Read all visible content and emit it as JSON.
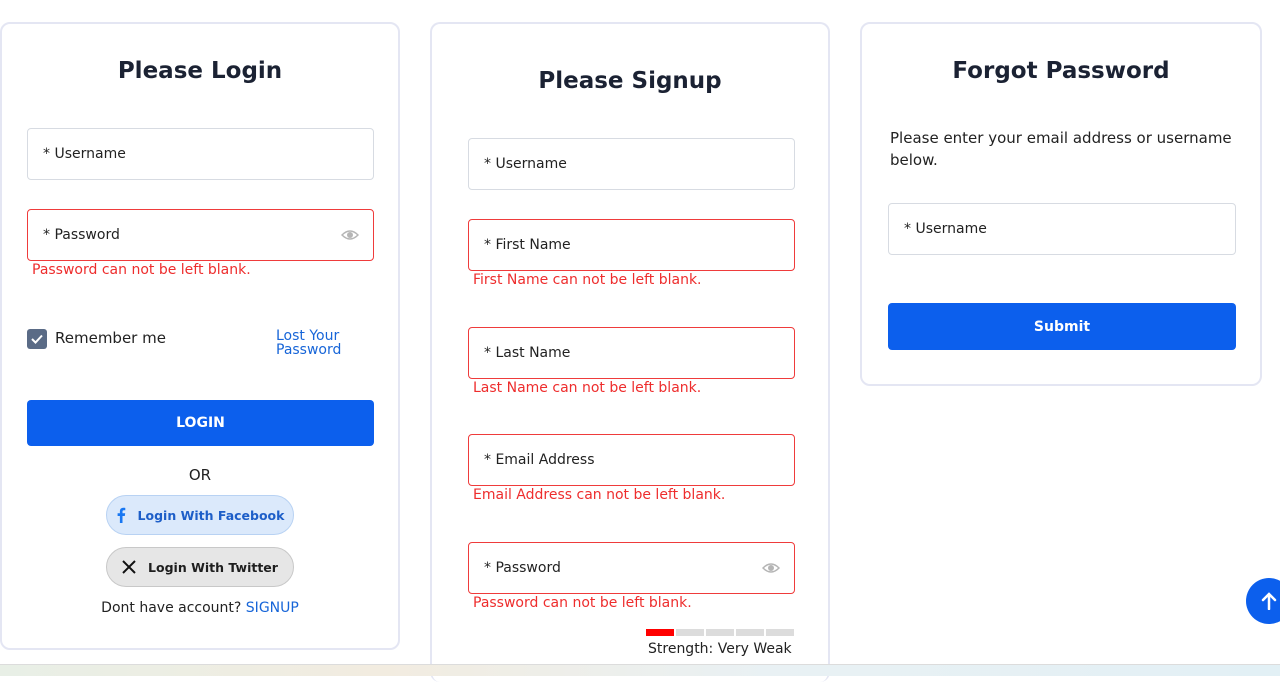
{
  "login": {
    "title": "Please Login",
    "username_placeholder": "* Username",
    "password_placeholder": "* Password",
    "password_error": "Password can not be left blank.",
    "remember_label": "Remember me",
    "lost_password_line1": "Lost Your",
    "lost_password_line2": "Password",
    "login_button": "LOGIN",
    "or_text": "OR",
    "facebook_button": "Login With Facebook",
    "twitter_button": "Login With Twitter",
    "no_account_text": "Dont have account?",
    "signup_link": "SIGNUP"
  },
  "signup": {
    "title": "Please Signup",
    "username_placeholder": "* Username",
    "first_name_placeholder": "* First Name",
    "first_name_error": "First Name can not be left blank.",
    "last_name_placeholder": "* Last Name",
    "last_name_error": "Last Name can not be left blank.",
    "email_placeholder": "* Email Address",
    "email_error": "Email Address can not be left blank.",
    "password_placeholder": "* Password",
    "password_error": "Password can not be left blank.",
    "strength_label": "Strength: Very Weak",
    "strength_level": 1,
    "strength_max": 5
  },
  "forgot": {
    "title": "Forgot Password",
    "instructions": "Please enter your email address or username below.",
    "username_placeholder": "* Username",
    "submit_button": "Submit"
  },
  "colors": {
    "accent": "#0c5fed",
    "error": "#ee2d2d",
    "strength_weak": "#ff0000"
  },
  "icons": {
    "password_toggle": "eye-icon",
    "checkbox": "checkmark-icon",
    "facebook": "facebook-icon",
    "twitter": "x-twitter-icon",
    "scroll_top": "arrow-up-icon"
  }
}
